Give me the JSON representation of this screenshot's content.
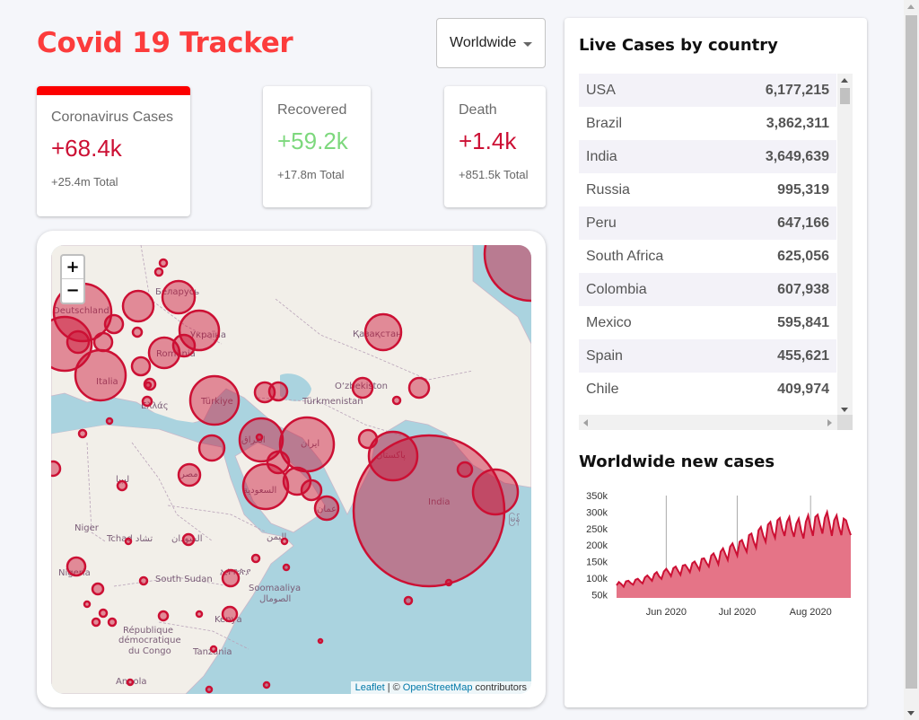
{
  "app": {
    "title": "Covid 19 Tracker"
  },
  "country_select": {
    "value": "Worldwide"
  },
  "stats": [
    {
      "label": "Coronavirus Cases",
      "value": "+68.4k",
      "total": "+25.4m Total"
    },
    {
      "label": "Recovered",
      "value": "+59.2k",
      "total": "+17.8m Total"
    },
    {
      "label": "Death",
      "value": "+1.4k",
      "total": "+851.5k Total"
    }
  ],
  "map": {
    "zoom_in": "+",
    "zoom_out": "−",
    "attribution_leaflet": "Leaflet",
    "attribution_sep": "| ©",
    "attribution_osm": "OpenStreetMap",
    "attribution_tail": "contributors",
    "labels": {
      "deutschland": "Deutschland",
      "belarus": "Беларусь",
      "ukraina": "Україна",
      "romania": "România",
      "italia": "Italia",
      "ellas": "Ελλάς",
      "turkiye": "Türkiye",
      "kazakhstan": "Қазақстан",
      "uzbekistan": "O‘zbekiston",
      "turkmenistan": "Türkmenistan",
      "iraq": "العراق",
      "iran": "ایران",
      "pakistan": "پاکستان",
      "india": "India",
      "saudi": "السعودية",
      "oman": "عمان",
      "libya": "ليبيا",
      "egypt": "مصر",
      "niger": "Niger",
      "tchad": "Tchad تشاد",
      "sudan_ar": "السودان",
      "yemen": "اليمن",
      "nigeria": "Nigeria",
      "south_sudan": "South Sudan",
      "ethiopia": "ኢትዮጵያ",
      "somalia": "Soomaaliya",
      "somalia_ar": "الصومال",
      "drc1": "République",
      "drc2": "démocratique",
      "drc3": "du Congo",
      "kenya": "Kenya",
      "tanzania": "Tanzania",
      "angola": "Angola",
      "myanmar": "မြန်"
    }
  },
  "live_cases": {
    "title": "Live Cases by country",
    "rows": [
      {
        "country": "USA",
        "cases": "6,177,215"
      },
      {
        "country": "Brazil",
        "cases": "3,862,311"
      },
      {
        "country": "India",
        "cases": "3,649,639"
      },
      {
        "country": "Russia",
        "cases": "995,319"
      },
      {
        "country": "Peru",
        "cases": "647,166"
      },
      {
        "country": "South Africa",
        "cases": "625,056"
      },
      {
        "country": "Colombia",
        "cases": "607,938"
      },
      {
        "country": "Mexico",
        "cases": "595,841"
      },
      {
        "country": "Spain",
        "cases": "455,621"
      },
      {
        "country": "Chile",
        "cases": "409,974"
      }
    ]
  },
  "colors": {
    "brand": "#fc3c3c",
    "cases": "#cc1034",
    "recovered": "#7dd87d",
    "selected_bar": "#fc0000",
    "chart_fill": "#e57487"
  },
  "chart_data": {
    "type": "area",
    "title": "Worldwide new cases",
    "xlabel": "",
    "ylabel": "",
    "ylim": [
      40000,
      350000
    ],
    "yticks": [
      "350k",
      "300k",
      "250k",
      "200k",
      "150k",
      "100k",
      "50k"
    ],
    "ytick_values": [
      350000,
      300000,
      250000,
      200000,
      150000,
      100000,
      50000
    ],
    "xticks": [
      "Jun 2020",
      "Jul 2020",
      "Aug 2020"
    ],
    "xtick_days": [
      21,
      51,
      82
    ],
    "series": [
      {
        "values": [
          78000,
          88000,
          82000,
          74000,
          90000,
          92000,
          85000,
          80000,
          95000,
          98000,
          90000,
          84000,
          102000,
          108000,
          100000,
          92000,
          112000,
          118000,
          105000,
          98000,
          120000,
          128000,
          118000,
          106000,
          130000,
          135000,
          122000,
          110000,
          138000,
          140000,
          130000,
          118000,
          145000,
          150000,
          138000,
          125000,
          158000,
          160000,
          146000,
          135000,
          168000,
          175000,
          160000,
          142000,
          180000,
          190000,
          172000,
          155000,
          195000,
          205000,
          186000,
          168000,
          210000,
          215000,
          195000,
          180000,
          230000,
          235000,
          210000,
          192000,
          245000,
          255000,
          228000,
          210000,
          262000,
          270000,
          240000,
          222000,
          275000,
          282000,
          250000,
          228000,
          270000,
          285000,
          248000,
          225000,
          265000,
          280000,
          245000,
          220000,
          270000,
          290000,
          255000,
          228000,
          285000,
          292000,
          262000,
          235000,
          282000,
          300000,
          265000,
          228000,
          275000,
          290000,
          255000,
          230000,
          280000,
          275000,
          250000,
          230000
        ]
      }
    ],
    "grid": false,
    "legend": "none"
  }
}
